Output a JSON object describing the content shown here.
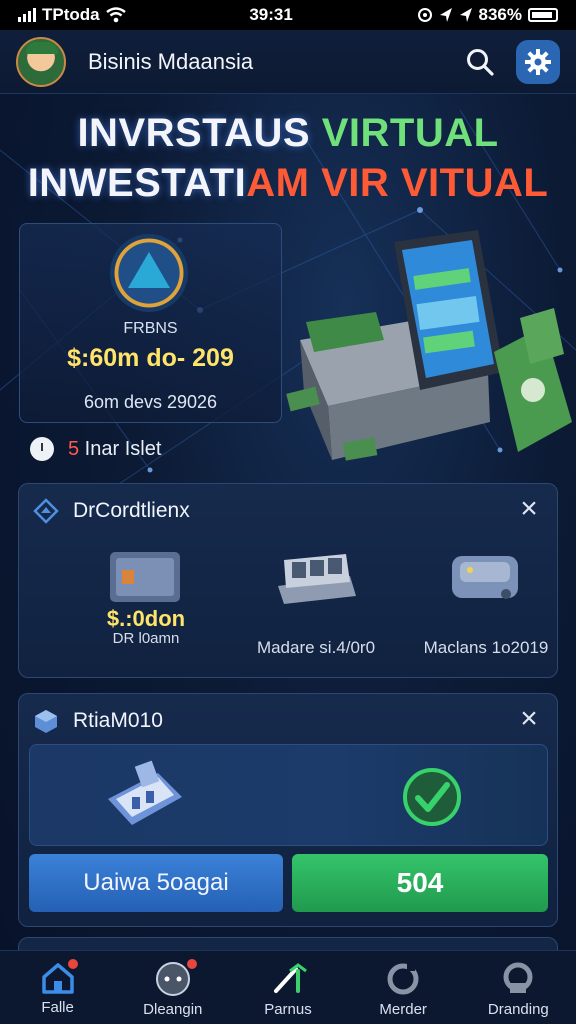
{
  "status_bar": {
    "carrier": "TPtoda",
    "time": "39:31",
    "battery": "836%"
  },
  "header": {
    "title": "Bisinis Mdaansia",
    "search_icon": "search-icon",
    "settings_icon": "gear-icon"
  },
  "hero": {
    "line1_a": "INVRSTAUS ",
    "line1_b": "VIRTUAL",
    "line2_a": "INWESTATI",
    "line2_b": "AM ",
    "line2_c": "VIR VITUAL"
  },
  "info_card": {
    "label": "FRBNS",
    "amount": "$:60m do- 209",
    "subtitle": "6om devs 29026"
  },
  "live": {
    "number": "5",
    "text": " Inar Islet"
  },
  "products_panel": {
    "title": "DrCordtlienx",
    "items": [
      {
        "price": "$.:0don",
        "name": "DR l0amn"
      },
      {
        "name": "Madare si.4/0r0"
      },
      {
        "name": "Maclans 1o2019"
      }
    ]
  },
  "action_panel": {
    "title": "RtiaM010",
    "primary_label": "Uaiwa 5oagai",
    "secondary_label": "504"
  },
  "nav": {
    "items": [
      {
        "label": "Falle"
      },
      {
        "label": "Dleangin"
      },
      {
        "label": "Parnus"
      },
      {
        "label": "Merder"
      },
      {
        "label": "Dranding"
      }
    ]
  },
  "colors": {
    "accent_blue": "#2b66b3",
    "accent_green": "#34c46a",
    "highlight_yellow": "#ffe46a",
    "alert_red": "#e8453c"
  }
}
